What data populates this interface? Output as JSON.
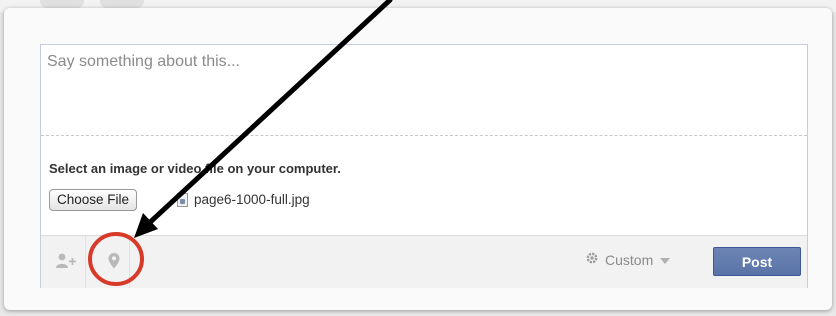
{
  "composer": {
    "placeholder": "Say something about this...",
    "select_label": "Select an image or video file on your computer.",
    "choose_file_label": "Choose File",
    "file_name": "page6-1000-full.jpg"
  },
  "footer": {
    "audience_label": "Custom",
    "post_label": "Post"
  },
  "colors": {
    "post_button": "#5b74a8",
    "annotation_circle": "#d83a2a",
    "annotation_arrow": "#000000"
  },
  "icons": [
    "tag-people-icon",
    "location-pin-icon",
    "gear-icon",
    "caret-down-icon",
    "image-file-icon"
  ]
}
